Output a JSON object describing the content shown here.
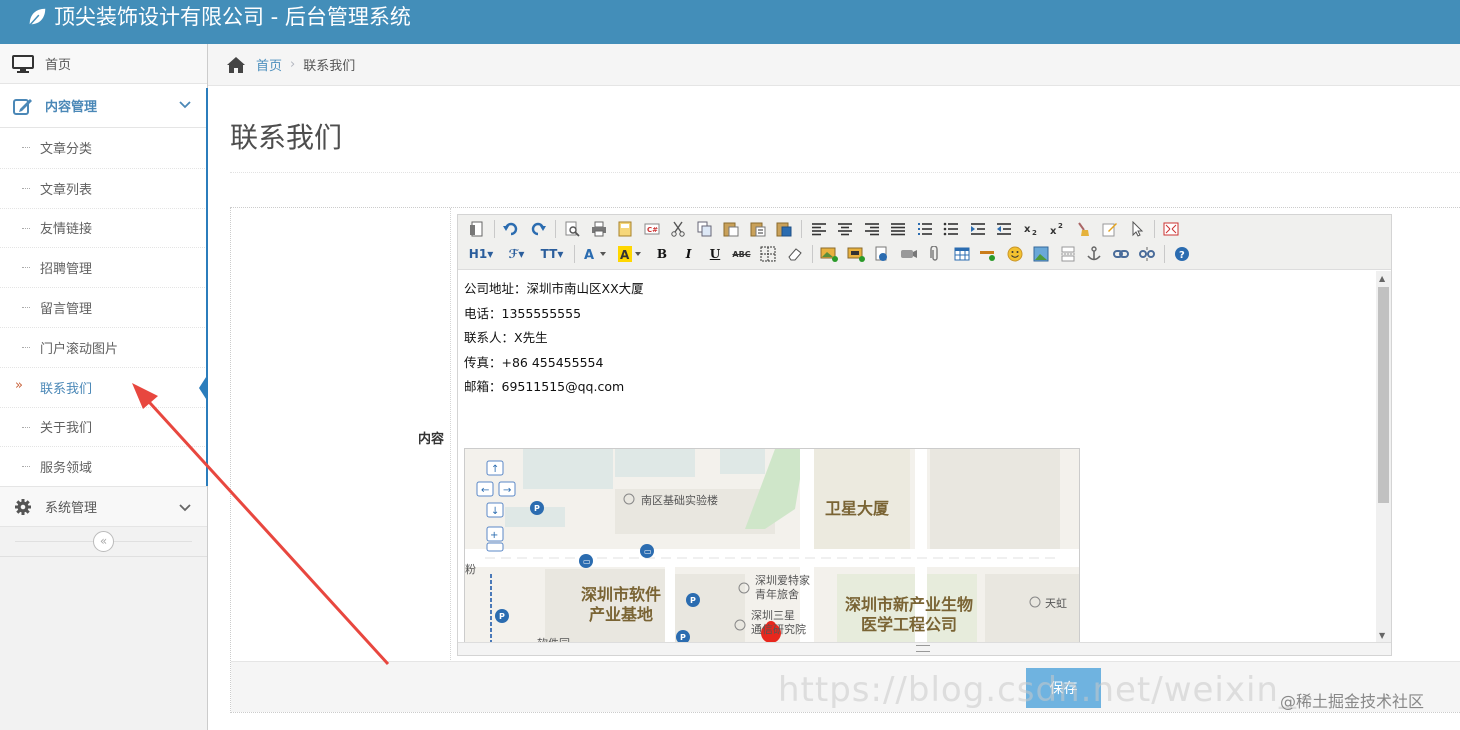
{
  "header": {
    "title": "顶尖装饰设计有限公司 - 后台管理系统"
  },
  "sidebar": {
    "home": "首页",
    "content_menu": "内容管理",
    "content_items": [
      {
        "label": "文章分类"
      },
      {
        "label": "文章列表"
      },
      {
        "label": "友情链接"
      },
      {
        "label": "招聘管理"
      },
      {
        "label": "留言管理"
      },
      {
        "label": "门户滚动图片"
      },
      {
        "label": "联系我们",
        "active": true
      },
      {
        "label": "关于我们"
      },
      {
        "label": "服务领域"
      }
    ],
    "system_menu": "系统管理",
    "active_marker": "»",
    "collapse": "«"
  },
  "breadcrumb": {
    "home": "首页",
    "separator": "›",
    "current": "联系我们"
  },
  "page": {
    "title": "联系我们"
  },
  "form": {
    "content_label": "内容",
    "save_button": "保存"
  },
  "editor": {
    "lines": [
      "公司地址：深圳市南山区XX大厦",
      "电话：1355555555",
      "联系人：X先生",
      "传真：+86 455455554",
      "邮箱：69511515@qq.com"
    ],
    "toolbar_text": {
      "h1": "H1",
      "font": "ℱ",
      "size": "TT",
      "bold": "B",
      "italic": "I",
      "underline": "U",
      "strike": "ABC"
    }
  },
  "map": {
    "labels": {
      "lab": "南区基础实验楼",
      "tower": "卫星大厦",
      "base": "深圳市软件\n产业基地",
      "hostel": "深圳爱特家\n青年旅舍",
      "samsung": "深圳三星\n通信研究院",
      "bio": "深圳市新产业生物\n医学工程公司",
      "tianhong": "天虹",
      "fen": "粉",
      "park": "软件园"
    }
  },
  "overlay": {
    "watermark": "https://blog.csdn.net/weixin_",
    "credit": "@稀土掘金技术社区"
  },
  "colors": {
    "header": "#438eb9",
    "link": "#4c8fbd",
    "annotation": "#e8473f",
    "save": "#6fb3e0"
  }
}
